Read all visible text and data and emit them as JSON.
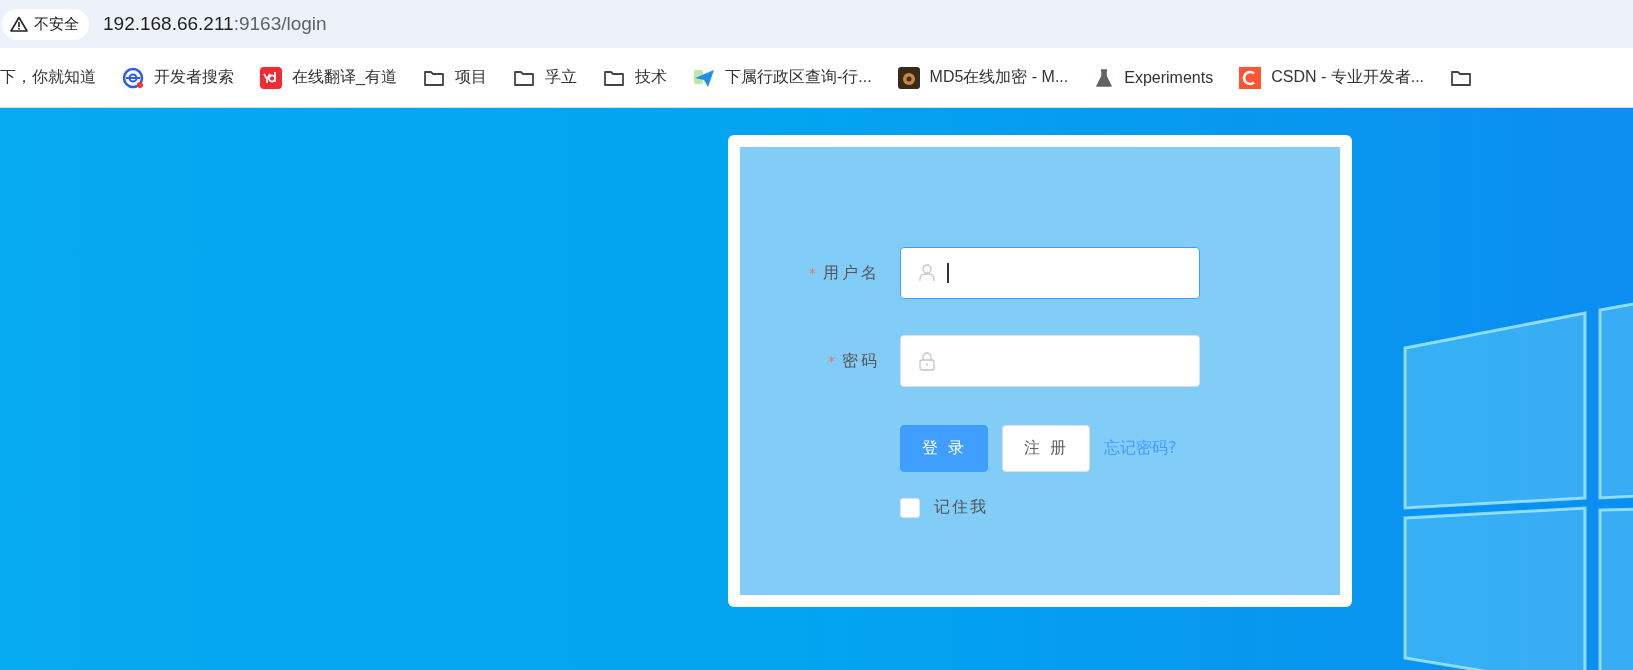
{
  "browser": {
    "security_label": "不安全",
    "url_host": "192.168.66.211",
    "url_rest": ":9163/login"
  },
  "bookmarks": [
    {
      "kind": "none",
      "label": "下，你就知道"
    },
    {
      "kind": "search",
      "label": "开发者搜索"
    },
    {
      "kind": "youdao",
      "label": "在线翻译_有道"
    },
    {
      "kind": "folder",
      "label": "项目"
    },
    {
      "kind": "folder",
      "label": "孚立"
    },
    {
      "kind": "folder",
      "label": "技术"
    },
    {
      "kind": "plane",
      "label": "下属行政区查询-行..."
    },
    {
      "kind": "lock",
      "label": "MD5在线加密 - M..."
    },
    {
      "kind": "flask",
      "label": "Experiments"
    },
    {
      "kind": "csdn",
      "label": "CSDN - 专业开发者..."
    },
    {
      "kind": "folder"
    }
  ],
  "login_form": {
    "fields": [
      {
        "kind": "user",
        "required_mark": "*",
        "label": "用户名",
        "focused": true
      },
      {
        "kind": "password",
        "required_mark": "*",
        "label": "密码",
        "focused": false
      }
    ],
    "buttons": [
      {
        "kind": "primary",
        "label": "登 录"
      },
      {
        "kind": "default",
        "label": "注 册"
      }
    ],
    "forgot_link": "忘记密码?",
    "remember": {
      "label": "记住我",
      "checked": false
    }
  }
}
